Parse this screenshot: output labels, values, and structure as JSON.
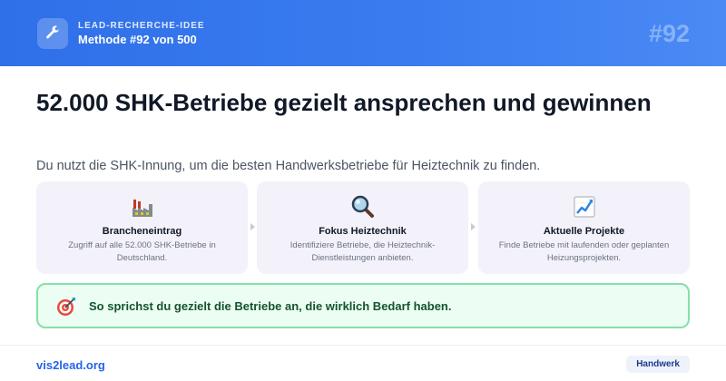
{
  "header": {
    "kicker": "LEAD-RECHERCHE-IDEE",
    "subtitle": "Methode #92 von 500",
    "number": "#92",
    "icon": "wrench-icon"
  },
  "main": {
    "title": "52.000 SHK-Betriebe gezielt ansprechen und gewinnen",
    "subtitle": "Du nutzt die SHK-Innung, um die besten Handwerksbetriebe für Heiztechnik zu finden."
  },
  "cards": [
    {
      "icon": "factory-icon",
      "title": "Brancheneintrag",
      "description": "Zugriff auf alle 52.000 SHK-Betriebe in Deutschland."
    },
    {
      "icon": "magnifier-icon",
      "title": "Fokus Heiztechnik",
      "description": "Identifiziere Betriebe, die Heiztechnik-Dienstleistungen anbieten."
    },
    {
      "icon": "chart-up-icon",
      "title": "Aktuelle Projekte",
      "description": "Finde Betriebe mit laufenden oder geplanten Heizungsprojekten."
    }
  ],
  "tip": {
    "icon": "target-icon",
    "text": "So sprichst du gezielt die Betriebe an, die wirklich Bedarf haben."
  },
  "footer": {
    "brand": "vis2lead.org",
    "badge": "Handwerk"
  },
  "colors": {
    "header_blue": "#2f6fe8",
    "card_bg": "#f3f2fa",
    "tip_bg": "#ecfdf3",
    "tip_border": "#86e0a6",
    "tip_text": "#14532d",
    "brand_blue": "#2563eb"
  }
}
